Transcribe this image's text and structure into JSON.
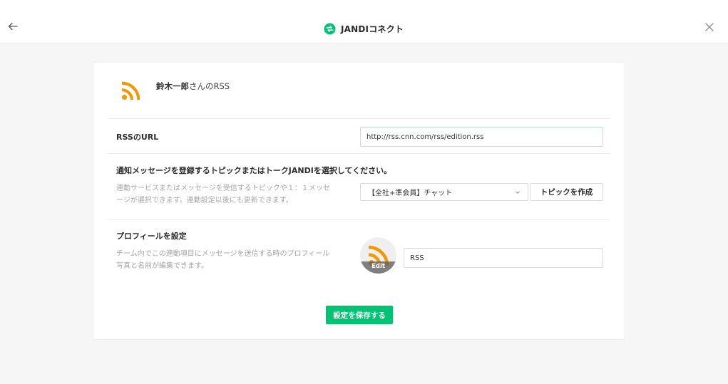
{
  "header": {
    "title": "JANDIコネクト",
    "back_icon": "back-arrow-icon",
    "close_icon": "close-icon",
    "logo_icon": "jandi-connect-logo-icon",
    "brand_color": "#00c473"
  },
  "card": {
    "head": {
      "user_name": "鈴木一郎",
      "suffix": "さんのRSS",
      "icon": "rss-icon",
      "icon_color": "#f39800"
    },
    "rss_url": {
      "label": "RSSのURL",
      "value": "http://rss.cnn.com/rss/edition.rss"
    },
    "topic": {
      "label": "通知メッセージを登録するトピックまたはトークJANDIを選択してください。",
      "desc_line1": "連動サービスまたはメッセージを受信するトピックや１：１メッセ",
      "desc_line2": "ージが選択できます。連動設定以後にも更新できます。",
      "selected": "【全社+準会員】チャット",
      "create_button": "トピックを作成"
    },
    "profile": {
      "label": "プロフィールを設定",
      "desc_line1": "チーム内でこの連動項目にメッセージを送信する時のプロフィール",
      "desc_line2": "写真と名前が編集できます。",
      "edit_label": "Edit",
      "name_value": "RSS"
    },
    "save_button": "設定を保存する"
  }
}
